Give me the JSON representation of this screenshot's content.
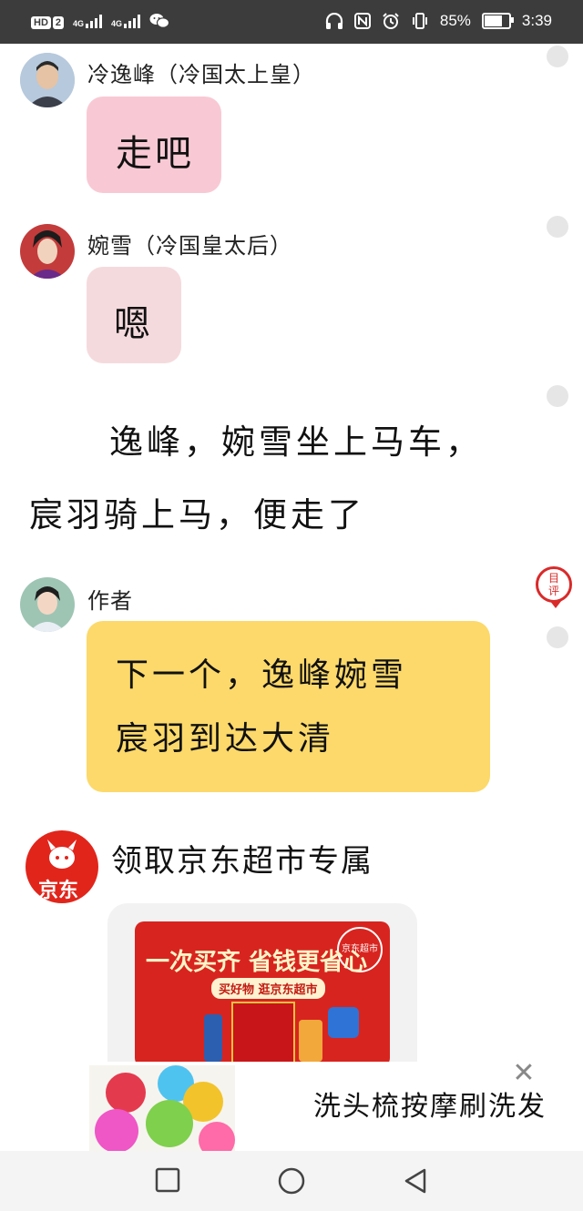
{
  "status_bar": {
    "hd_label": "HD",
    "sim_slot": "2",
    "network_1": "4G",
    "network_2": "4G",
    "battery_percent": "85%",
    "battery_level": 0.85,
    "time": "3:39"
  },
  "messages": [
    {
      "sender": "冷逸峰（冷国太上皇）",
      "text": "走吧",
      "bubble_color": "#f8c9d4"
    },
    {
      "sender": "婉雪（冷国皇太后）",
      "text": "嗯",
      "bubble_color": "#f5dadd"
    }
  ],
  "narration": {
    "line1": "逸峰，婉雪坐上马车，",
    "line2": "宸羽骑上马，便走了"
  },
  "author": {
    "sender": "作者",
    "line1": "下一个，逸峰婉雪",
    "line2": "宸羽到达大清",
    "bubble_color": "#fcd96a"
  },
  "comment_stamp": {
    "line1": "目",
    "line2": "评"
  },
  "ad": {
    "logo_text": "京东",
    "title": "领取京东超市专属",
    "image_headline": "一次买齐 省钱更省心",
    "image_subline": "买好物 逛京东超市",
    "image_badge": "京东超市"
  },
  "float_ad": {
    "text": "洗头梳按摩刷洗发"
  },
  "colors": {
    "accent_red": "#e1251b",
    "status_bar_bg": "#3c3c3c"
  }
}
